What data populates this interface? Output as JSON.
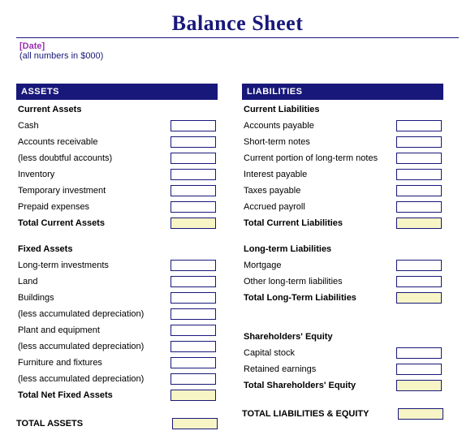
{
  "title": "Balance Sheet",
  "meta": {
    "date_placeholder": "[Date]",
    "units_note": "(all numbers in $000)"
  },
  "left": {
    "section_header": "ASSETS",
    "group1": {
      "heading": "Current Assets",
      "rows": [
        {
          "label": "Cash",
          "indent": 0
        },
        {
          "label": "Accounts receivable",
          "indent": 0
        },
        {
          "label": "(less doubtful accounts)",
          "indent": 1
        },
        {
          "label": "Inventory",
          "indent": 0
        },
        {
          "label": "Temporary investment",
          "indent": 0
        },
        {
          "label": "Prepaid expenses",
          "indent": 0
        }
      ],
      "total_label": "Total Current Assets"
    },
    "group2": {
      "heading": "Fixed Assets",
      "rows": [
        {
          "label": "Long-term investments",
          "indent": 0
        },
        {
          "label": "Land",
          "indent": 0
        },
        {
          "label": "Buildings",
          "indent": 0
        },
        {
          "label": "(less accumulated depreciation)",
          "indent": 1
        },
        {
          "label": "Plant and equipment",
          "indent": 0
        },
        {
          "label": "(less accumulated depreciation)",
          "indent": 1
        },
        {
          "label": "Furniture and fixtures",
          "indent": 0
        },
        {
          "label": "(less accumulated depreciation)",
          "indent": 1
        }
      ],
      "total_label": "Total Net Fixed Assets"
    },
    "grand_total": "TOTAL ASSETS"
  },
  "right": {
    "section_header": "LIABILITIES",
    "group1": {
      "heading": "Current Liabilities",
      "rows": [
        {
          "label": "Accounts payable",
          "indent": 0
        },
        {
          "label": "Short-term notes",
          "indent": 0
        },
        {
          "label": "Current portion of long-term notes",
          "indent": 0
        },
        {
          "label": "Interest payable",
          "indent": 0
        },
        {
          "label": "Taxes payable",
          "indent": 0
        },
        {
          "label": "Accrued payroll",
          "indent": 0
        }
      ],
      "total_label": "Total Current Liabilities"
    },
    "group2": {
      "heading": "Long-term Liabilities",
      "rows": [
        {
          "label": "Mortgage",
          "indent": 0
        },
        {
          "label": "Other long-term liabilities",
          "indent": 0
        }
      ],
      "total_label": "Total Long-Term Liabilities"
    },
    "group3": {
      "heading": "Shareholders' Equity",
      "rows": [
        {
          "label": "Capital stock",
          "indent": 0
        },
        {
          "label": "Retained earnings",
          "indent": 0
        }
      ],
      "total_label": "Total Shareholders' Equity"
    },
    "grand_total": "TOTAL LIABILITIES & EQUITY"
  }
}
